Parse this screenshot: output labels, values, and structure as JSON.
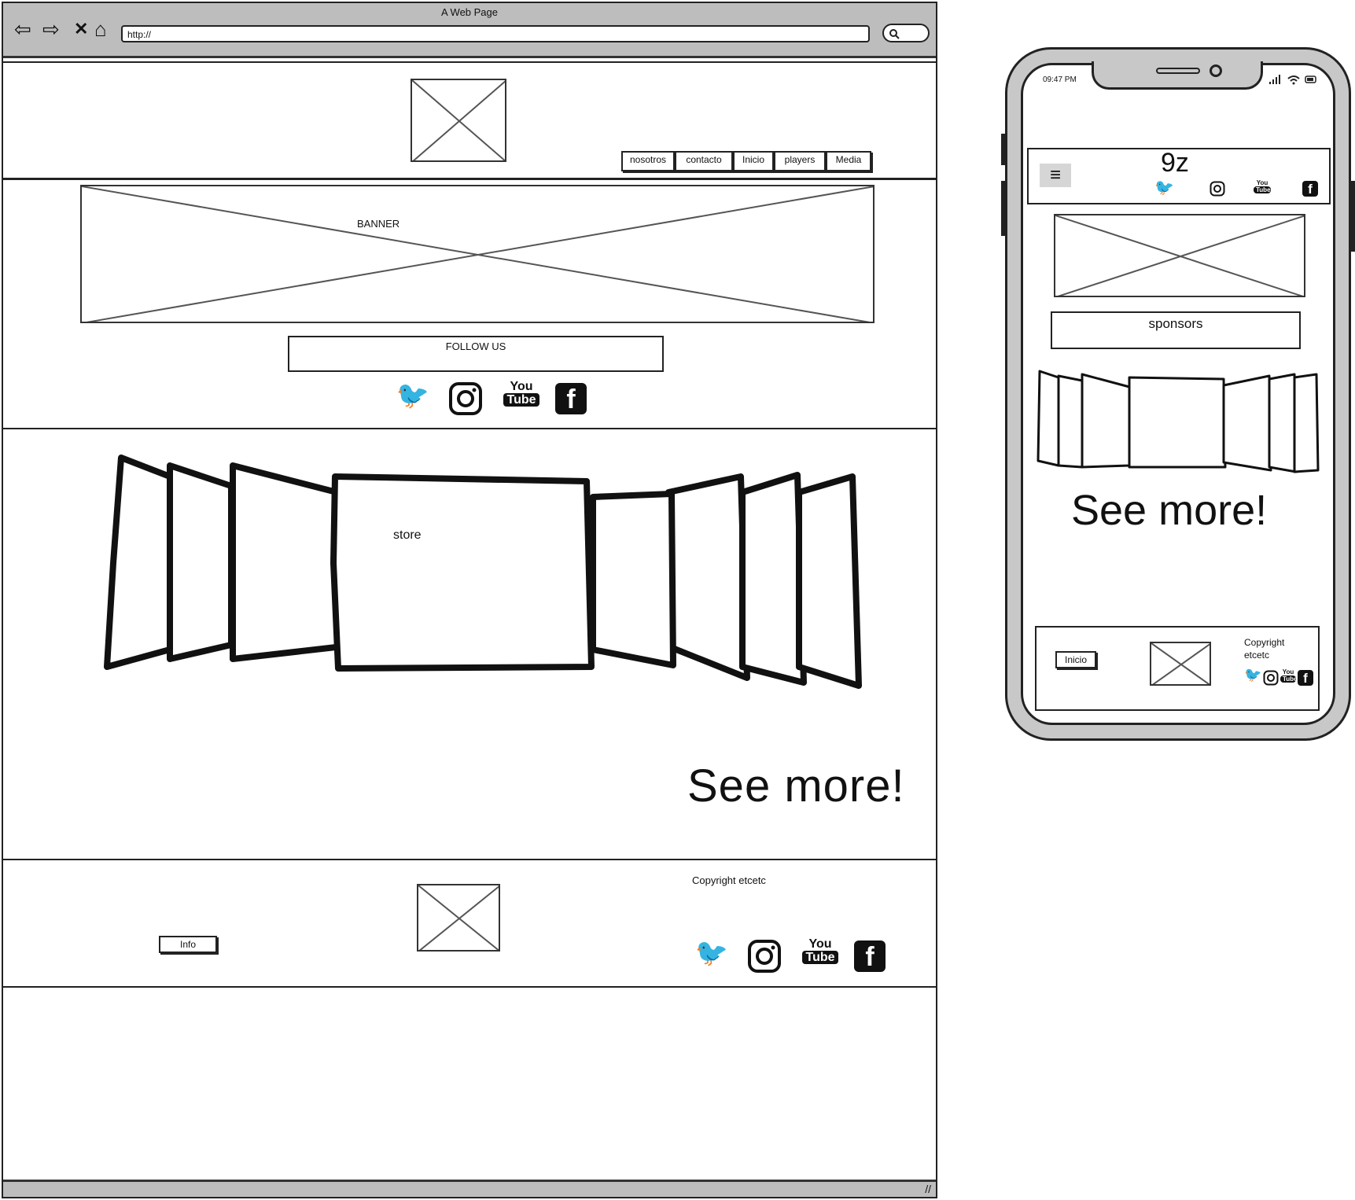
{
  "browser": {
    "title": "A Web Page",
    "url": "http://",
    "nav": {
      "back": "⇦",
      "forward": "⇨",
      "stop": "✕",
      "home": "⌂"
    }
  },
  "header": {
    "menu": [
      "nosotros",
      "contacto",
      "Inicio",
      "players",
      "Media"
    ]
  },
  "banner": {
    "label": "BANNER"
  },
  "follow": {
    "label": "FOLLOW US",
    "icons": [
      "twitter-icon",
      "instagram-icon",
      "youtube-icon",
      "facebook-icon"
    ]
  },
  "store": {
    "label": "store",
    "see_more": "See more!"
  },
  "footer": {
    "info_button": "Info",
    "copyright": "Copyright etcetc"
  },
  "social_text": {
    "youtube_top": "You",
    "youtube_bottom": "Tube",
    "facebook": "f",
    "twitter": "🐦",
    "instagram": "◎"
  },
  "phone": {
    "time": "09:47 PM",
    "logo": "9z",
    "menu_icon": "≡",
    "sponsors_label": "sponsors",
    "see_more": "See more!",
    "footer_button": "Inicio",
    "copyright_line1": "Copyright",
    "copyright_line2": "etcetc"
  }
}
